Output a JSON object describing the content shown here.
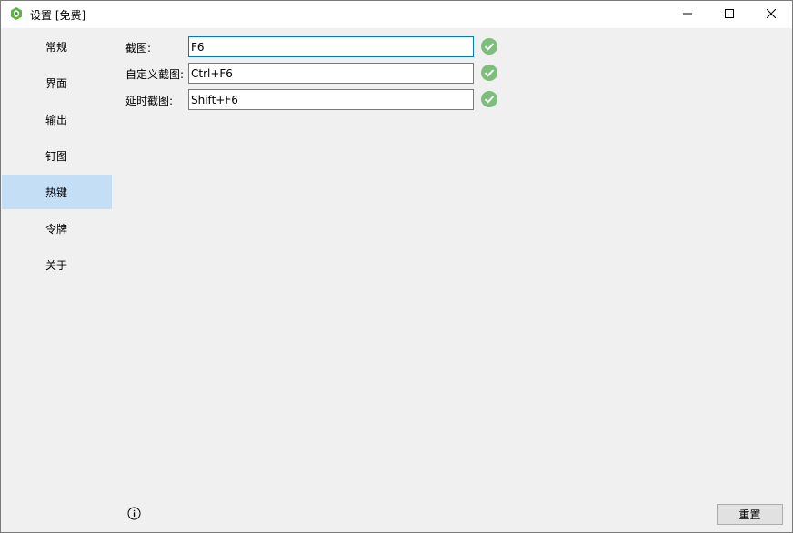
{
  "window": {
    "title": "设置 [免费]",
    "icon": "app-logo-icon"
  },
  "sidebar": {
    "items": [
      {
        "label": "常规"
      },
      {
        "label": "界面"
      },
      {
        "label": "输出"
      },
      {
        "label": "钉图"
      },
      {
        "label": "热键",
        "active": true
      },
      {
        "label": "令牌"
      },
      {
        "label": "关于"
      }
    ]
  },
  "hotkeys": [
    {
      "label": "截图:",
      "value": "F6",
      "status": "check-circle-icon"
    },
    {
      "label": "自定义截图:",
      "value": "Ctrl+F6",
      "status": "check-circle-icon"
    },
    {
      "label": "延时截图:",
      "value": "Shift+F6",
      "status": "check-circle-icon"
    }
  ],
  "footer": {
    "reset_label": "重置",
    "info_icon": "info-icon"
  },
  "colors": {
    "active_nav": "#c4def5",
    "check_green": "#7cbf7a",
    "focus_border": "#0078d7"
  }
}
